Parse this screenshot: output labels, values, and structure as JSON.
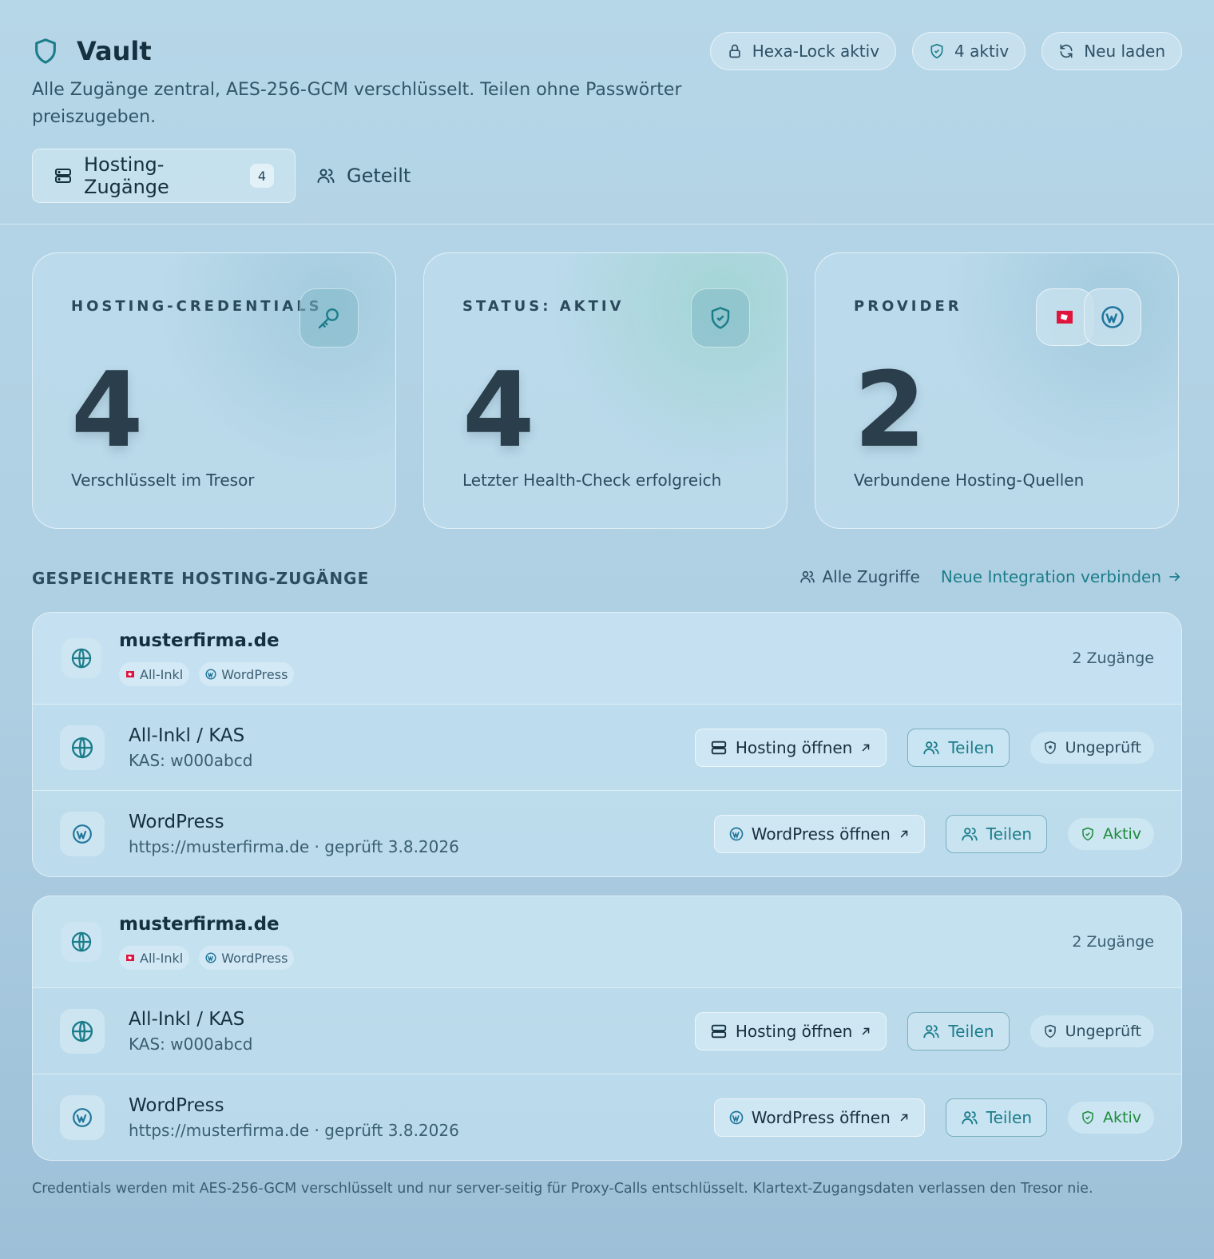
{
  "header": {
    "title": "Vault",
    "subtitle": "Alle Zugänge zentral, AES-256-GCM verschlüsselt. Teilen ohne Passwörter preiszugeben.",
    "pills": {
      "lock": "Hexa-Lock aktiv",
      "active": "4 aktiv",
      "reload": "Neu laden"
    }
  },
  "tabs": {
    "hosting": {
      "label": "Hosting-Zugänge",
      "count": "4"
    },
    "shared": {
      "label": "Geteilt"
    }
  },
  "stats": {
    "credentials": {
      "label": "HOSTING-CREDENTIALS",
      "value": "4",
      "desc": "Verschlüsselt im Tresor"
    },
    "status": {
      "label": "STATUS: AKTIV",
      "value": "4",
      "desc": "Letzter Health-Check erfolgreich"
    },
    "provider": {
      "label": "PROVIDER",
      "value": "2",
      "desc": "Verbundene Hosting-Quellen"
    }
  },
  "section": {
    "title": "GESPEICHERTE HOSTING-ZUGÄNGE",
    "all_access": "Alle Zugriffe",
    "new_integration": "Neue Integration verbinden"
  },
  "groups": [
    {
      "domain": "musterfirma.de",
      "chips": [
        "All-Inkl",
        "WordPress"
      ],
      "count": "2 Zugänge",
      "entries": [
        {
          "title": "All-Inkl / KAS",
          "sub": "KAS: w000abcd",
          "open": "Hosting öffnen",
          "share": "Teilen",
          "status": "Ungeprüft"
        },
        {
          "title": "WordPress",
          "sub": "https://musterfirma.de · geprüft 3.8.2026",
          "open": "WordPress öffnen",
          "share": "Teilen",
          "status": "Aktiv"
        }
      ]
    },
    {
      "domain": "musterfirma.de",
      "chips": [
        "All-Inkl",
        "WordPress"
      ],
      "count": "2 Zugänge",
      "entries": [
        {
          "title": "All-Inkl / KAS",
          "sub": "KAS: w000abcd",
          "open": "Hosting öffnen",
          "share": "Teilen",
          "status": "Ungeprüft"
        },
        {
          "title": "WordPress",
          "sub": "https://musterfirma.de · geprüft 3.8.2026",
          "open": "WordPress öffnen",
          "share": "Teilen",
          "status": "Aktiv"
        }
      ]
    }
  ],
  "footer": "Credentials werden mit AES-256-GCM verschlüsselt und nur server-seitig für Proxy-Calls entschlüsselt. Klartext-Zugangsdaten verlassen den Tresor nie.",
  "colors": {
    "accent": "#1c7d8a",
    "success": "#1e8a3c",
    "allinkl_red": "#e0143c",
    "wordpress_blue": "#21759b"
  },
  "icons": {
    "shield": "shield-icon",
    "lock": "lock-icon",
    "reload": "refresh-icon",
    "server": "server-icon",
    "users": "users-icon",
    "key": "key-icon",
    "globe": "globe-icon",
    "wordpress": "wordpress-icon",
    "allinkl": "allinkl-logo-icon",
    "arrow": "arrow-up-right-icon"
  }
}
